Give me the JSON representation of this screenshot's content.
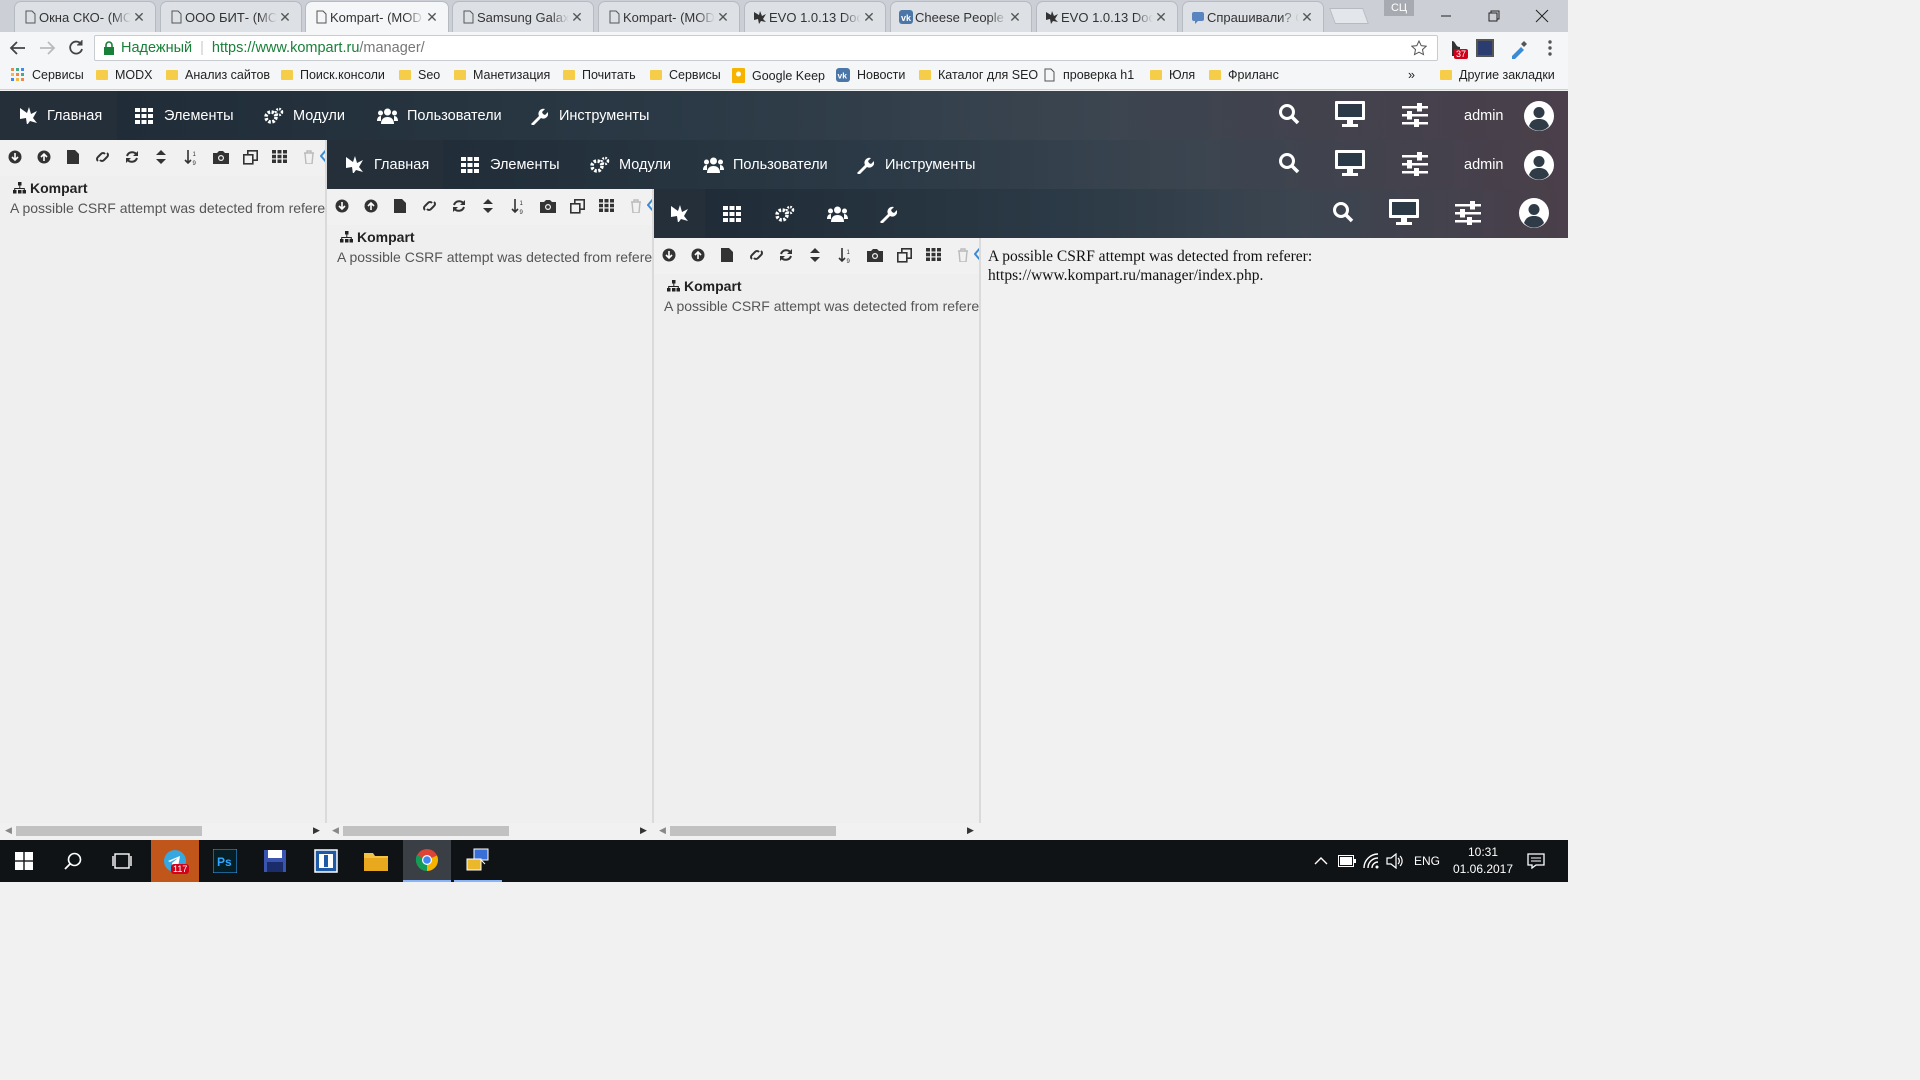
{
  "browser": {
    "tabs": [
      {
        "title": "Окна СКО- (МС",
        "icon": "page-icon"
      },
      {
        "title": "ООО БИТ- (МС",
        "icon": "page-icon"
      },
      {
        "title": "Kompart- (MOD",
        "icon": "page-icon",
        "active": true
      },
      {
        "title": "Samsung Galax",
        "icon": "page-icon"
      },
      {
        "title": "Kompart- (MOD",
        "icon": "page-icon"
      },
      {
        "title": "EVO 1.0.13 Doc",
        "icon": "evo-icon"
      },
      {
        "title": "Cheese People",
        "icon": "vk-icon"
      },
      {
        "title": "EVO 1.0.13 Doc",
        "icon": "evo-icon"
      },
      {
        "title": "Спрашивали? С",
        "icon": "chat-icon"
      }
    ],
    "profile_label": "СЦ",
    "secure_label": "Надежный",
    "url_host": "https://www.kompart.ru",
    "url_path": "/manager/",
    "ext_badge": "37",
    "bookmarks": [
      {
        "label": "Сервисы",
        "icon": "apps-icon"
      },
      {
        "label": "MODX",
        "icon": "folder-icon"
      },
      {
        "label": "Анализ сайтов",
        "icon": "folder-icon"
      },
      {
        "label": "Поиск.консоли",
        "icon": "folder-icon"
      },
      {
        "label": "Seo",
        "icon": "folder-icon"
      },
      {
        "label": "Манетизация",
        "icon": "folder-icon"
      },
      {
        "label": "Почитать",
        "icon": "folder-icon"
      },
      {
        "label": "Сервисы",
        "icon": "folder-icon"
      },
      {
        "label": "Google Keep",
        "icon": "keep-icon"
      },
      {
        "label": "Новости",
        "icon": "vk-icon"
      },
      {
        "label": "Каталог для SEO",
        "icon": "folder-icon"
      },
      {
        "label": "проверка h1",
        "icon": "page-icon"
      },
      {
        "label": "Юля",
        "icon": "folder-icon"
      },
      {
        "label": "Фриланс",
        "icon": "folder-icon"
      }
    ],
    "overflow_label": "»",
    "other_bookmarks": "Другие закладки"
  },
  "manager": {
    "nav": {
      "home": "Главная",
      "elements": "Элементы",
      "modules": "Модули",
      "users": "Пользователи",
      "tools": "Инструменты"
    },
    "user": "admin",
    "tree_root": "Kompart",
    "error_short": "A possible CSRF attempt was detected from referer: h",
    "error_full_line1": "A possible CSRF attempt was detected from referer:",
    "error_full_line2": "https://www.kompart.ru/manager/index.php."
  },
  "taskbar": {
    "telegram_badge": "117",
    "lang": "ENG",
    "time": "10:31",
    "date": "01.06.2017"
  },
  "colors": {
    "topbar": "#2b3a46",
    "accent_blue": "#3b8bd4",
    "folder": "#f5cd49"
  }
}
